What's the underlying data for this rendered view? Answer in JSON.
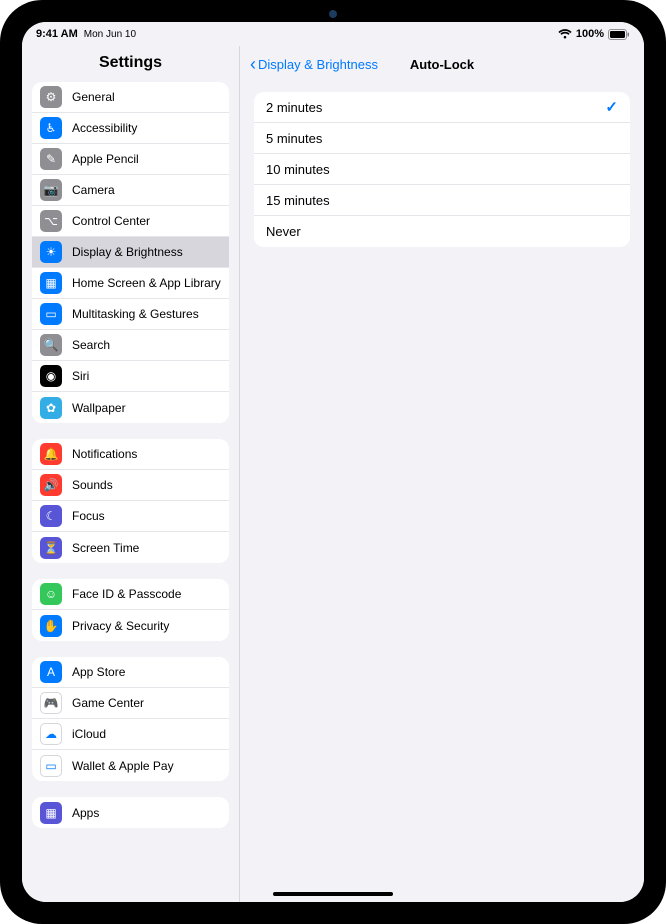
{
  "status": {
    "time": "9:41 AM",
    "date": "Mon Jun 10",
    "battery": "100%"
  },
  "sidebar": {
    "title": "Settings",
    "groups": [
      {
        "items": [
          {
            "label": "General",
            "iconClass": "ic-gray",
            "glyph": "⚙︎"
          },
          {
            "label": "Accessibility",
            "iconClass": "ic-blue",
            "glyph": "♿︎"
          },
          {
            "label": "Apple Pencil",
            "iconClass": "ic-gray",
            "glyph": "✎"
          },
          {
            "label": "Camera",
            "iconClass": "ic-gray",
            "glyph": "📷"
          },
          {
            "label": "Control Center",
            "iconClass": "ic-gray",
            "glyph": "⌥"
          },
          {
            "label": "Display & Brightness",
            "iconClass": "ic-blue",
            "glyph": "☀",
            "selected": true
          },
          {
            "label": "Home Screen & App Library",
            "iconClass": "ic-blue",
            "glyph": "▦"
          },
          {
            "label": "Multitasking & Gestures",
            "iconClass": "ic-blue",
            "glyph": "▭"
          },
          {
            "label": "Search",
            "iconClass": "ic-gray",
            "glyph": "🔍"
          },
          {
            "label": "Siri",
            "iconClass": "ic-black",
            "glyph": "◉"
          },
          {
            "label": "Wallpaper",
            "iconClass": "ic-cyan",
            "glyph": "✿"
          }
        ]
      },
      {
        "items": [
          {
            "label": "Notifications",
            "iconClass": "ic-red",
            "glyph": "🔔"
          },
          {
            "label": "Sounds",
            "iconClass": "ic-red",
            "glyph": "🔊"
          },
          {
            "label": "Focus",
            "iconClass": "ic-purple",
            "glyph": "☾"
          },
          {
            "label": "Screen Time",
            "iconClass": "ic-purple",
            "glyph": "⏳"
          }
        ]
      },
      {
        "items": [
          {
            "label": "Face ID & Passcode",
            "iconClass": "ic-green",
            "glyph": "☺"
          },
          {
            "label": "Privacy & Security",
            "iconClass": "ic-blue",
            "glyph": "✋"
          }
        ]
      },
      {
        "items": [
          {
            "label": "App Store",
            "iconClass": "ic-blue",
            "glyph": "A"
          },
          {
            "label": "Game Center",
            "iconClass": "ic-white",
            "glyph": "🎮"
          },
          {
            "label": "iCloud",
            "iconClass": "ic-white",
            "glyph": "☁"
          },
          {
            "label": "Wallet & Apple Pay",
            "iconClass": "ic-white",
            "glyph": "▭"
          }
        ]
      },
      {
        "items": [
          {
            "label": "Apps",
            "iconClass": "ic-purple",
            "glyph": "▦"
          }
        ]
      }
    ]
  },
  "detail": {
    "backLabel": "Display & Brightness",
    "title": "Auto-Lock",
    "options": [
      {
        "label": "2 minutes",
        "selected": true
      },
      {
        "label": "5 minutes",
        "selected": false
      },
      {
        "label": "10 minutes",
        "selected": false
      },
      {
        "label": "15 minutes",
        "selected": false
      },
      {
        "label": "Never",
        "selected": false
      }
    ]
  }
}
